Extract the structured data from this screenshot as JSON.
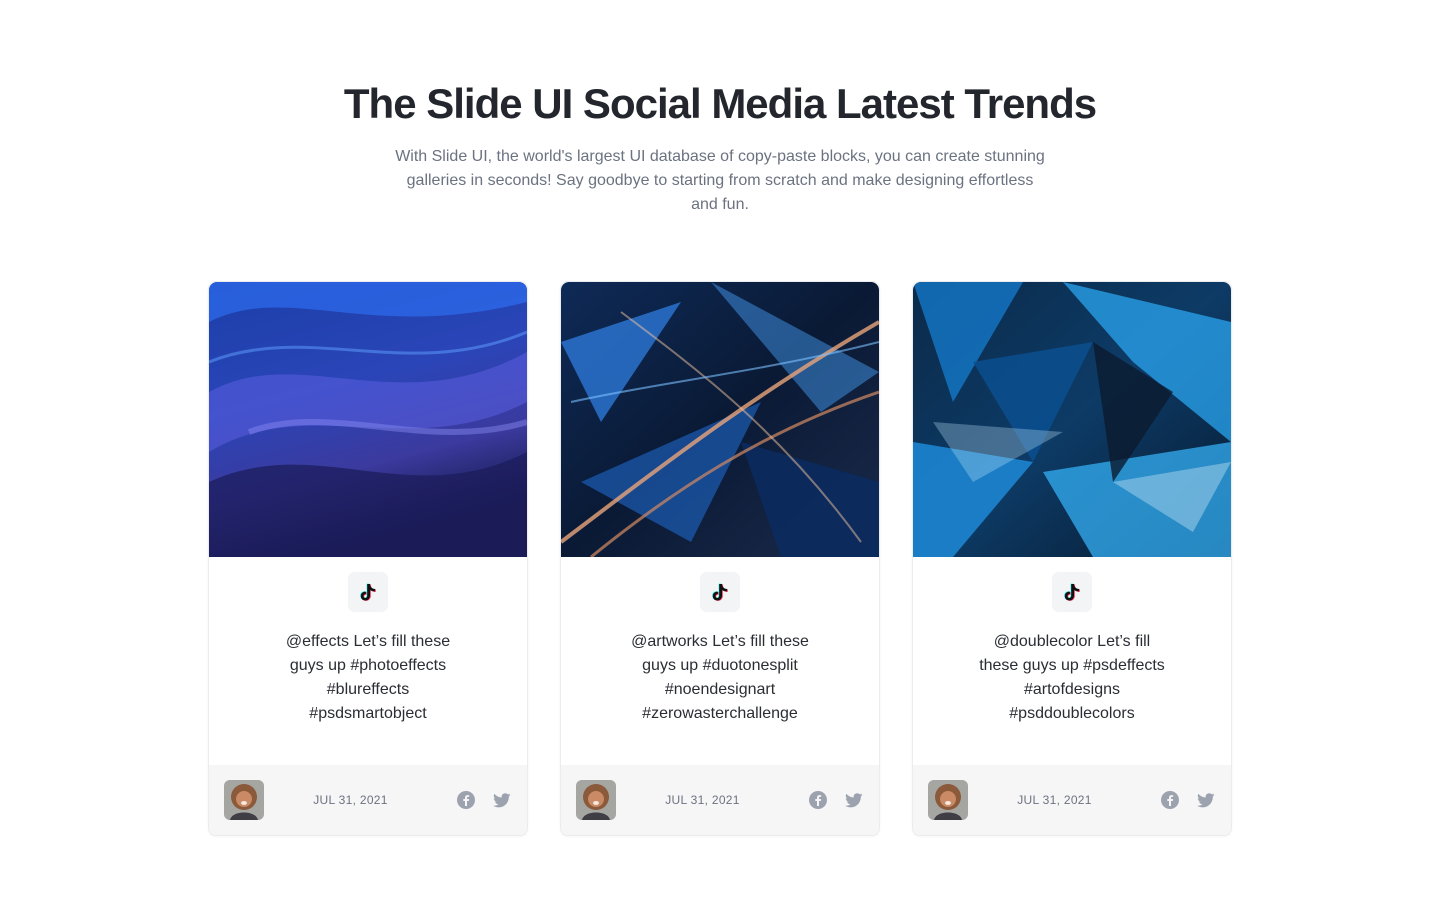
{
  "hero": {
    "title": "The Slide UI Social Media Latest Trends",
    "subtitle": "With Slide UI, the world's largest UI database of copy-paste blocks, you can create stunning galleries in seconds! Say goodbye to starting from scratch and make designing effortless and fun."
  },
  "colors": {
    "title": "#23272d",
    "muted": "#6b7280",
    "footer_bg": "#f6f6f7",
    "icon_gray": "#9ca3af"
  },
  "cards": [
    {
      "image_icon": "abstract-blue-waves-image",
      "platform_icon": "tiktok-icon",
      "text": "@effects Let’s fill these guys up #photoeffects #blureffects #psdsmartobject",
      "date": "JUL 31, 2021"
    },
    {
      "image_icon": "abstract-glass-shards-image",
      "platform_icon": "tiktok-icon",
      "text": "@artworks Let’s fill these guys up #duotonesplit #noendesignart #zerowasterchallenge",
      "date": "JUL 31, 2021"
    },
    {
      "image_icon": "abstract-blue-crystals-image",
      "platform_icon": "tiktok-icon",
      "text": "@doublecolor Let’s fill these guys up #psdeffects #artofdesigns #psddoublecolors",
      "date": "JUL 31, 2021"
    }
  ]
}
